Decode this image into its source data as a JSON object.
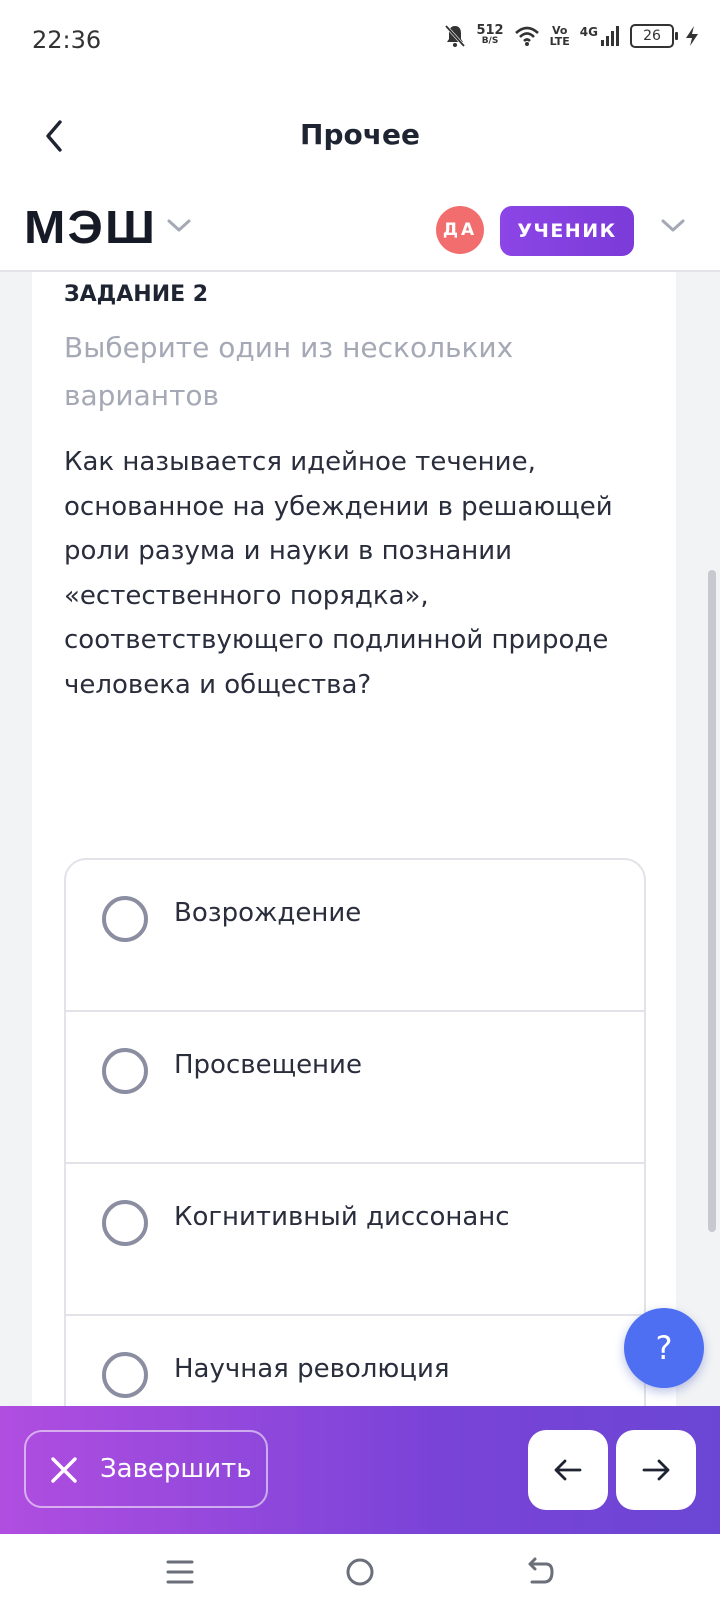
{
  "status_bar": {
    "time": "22:36",
    "net_speed_value": "512",
    "net_speed_unit": "B/S",
    "volte_top": "Vo",
    "volte_bottom": "LTE",
    "network": "4G",
    "battery": "26"
  },
  "header": {
    "title": "Прочее"
  },
  "brand": {
    "logo_text": "МЭШ",
    "avatar_initials": "ДА",
    "role": "УЧЕНИК"
  },
  "task": {
    "title": "ЗАДАНИЕ 2",
    "subtitle": "Выберите один из нескольких вариантов",
    "question": "Как называется идейное течение, основанное на убеждении в решающей роли разума и науки в познании «естественного порядка», соответствующего подлинной природе человека и общества?",
    "options": [
      {
        "label": "Возрождение"
      },
      {
        "label": "Просвещение"
      },
      {
        "label": "Когнитивный диссонанс"
      },
      {
        "label": "Научная революция"
      }
    ]
  },
  "help": {
    "label": "?"
  },
  "footer": {
    "finish_label": "Завершить"
  },
  "colors": {
    "accent": "#7b3bd9",
    "help": "#4f6ff2",
    "avatar": "#f26e6e"
  }
}
